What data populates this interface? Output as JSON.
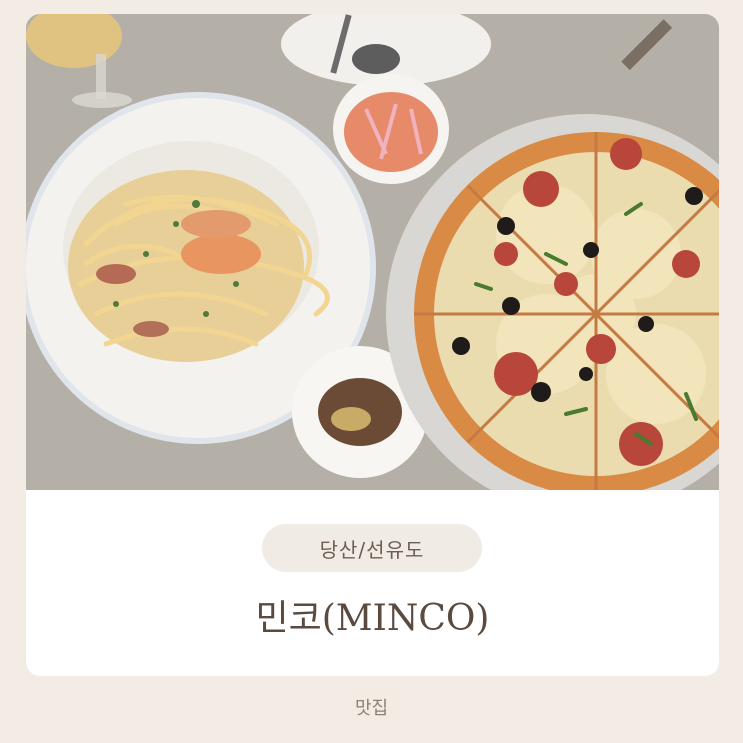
{
  "location_tag": "당산/선유도",
  "restaurant_name": "민코(MINCO)",
  "category": "맛집",
  "colors": {
    "background": "#f3ece5",
    "card": "#ffffff",
    "pill": "#f1ebe5",
    "title_text": "#5b4a3f"
  }
}
